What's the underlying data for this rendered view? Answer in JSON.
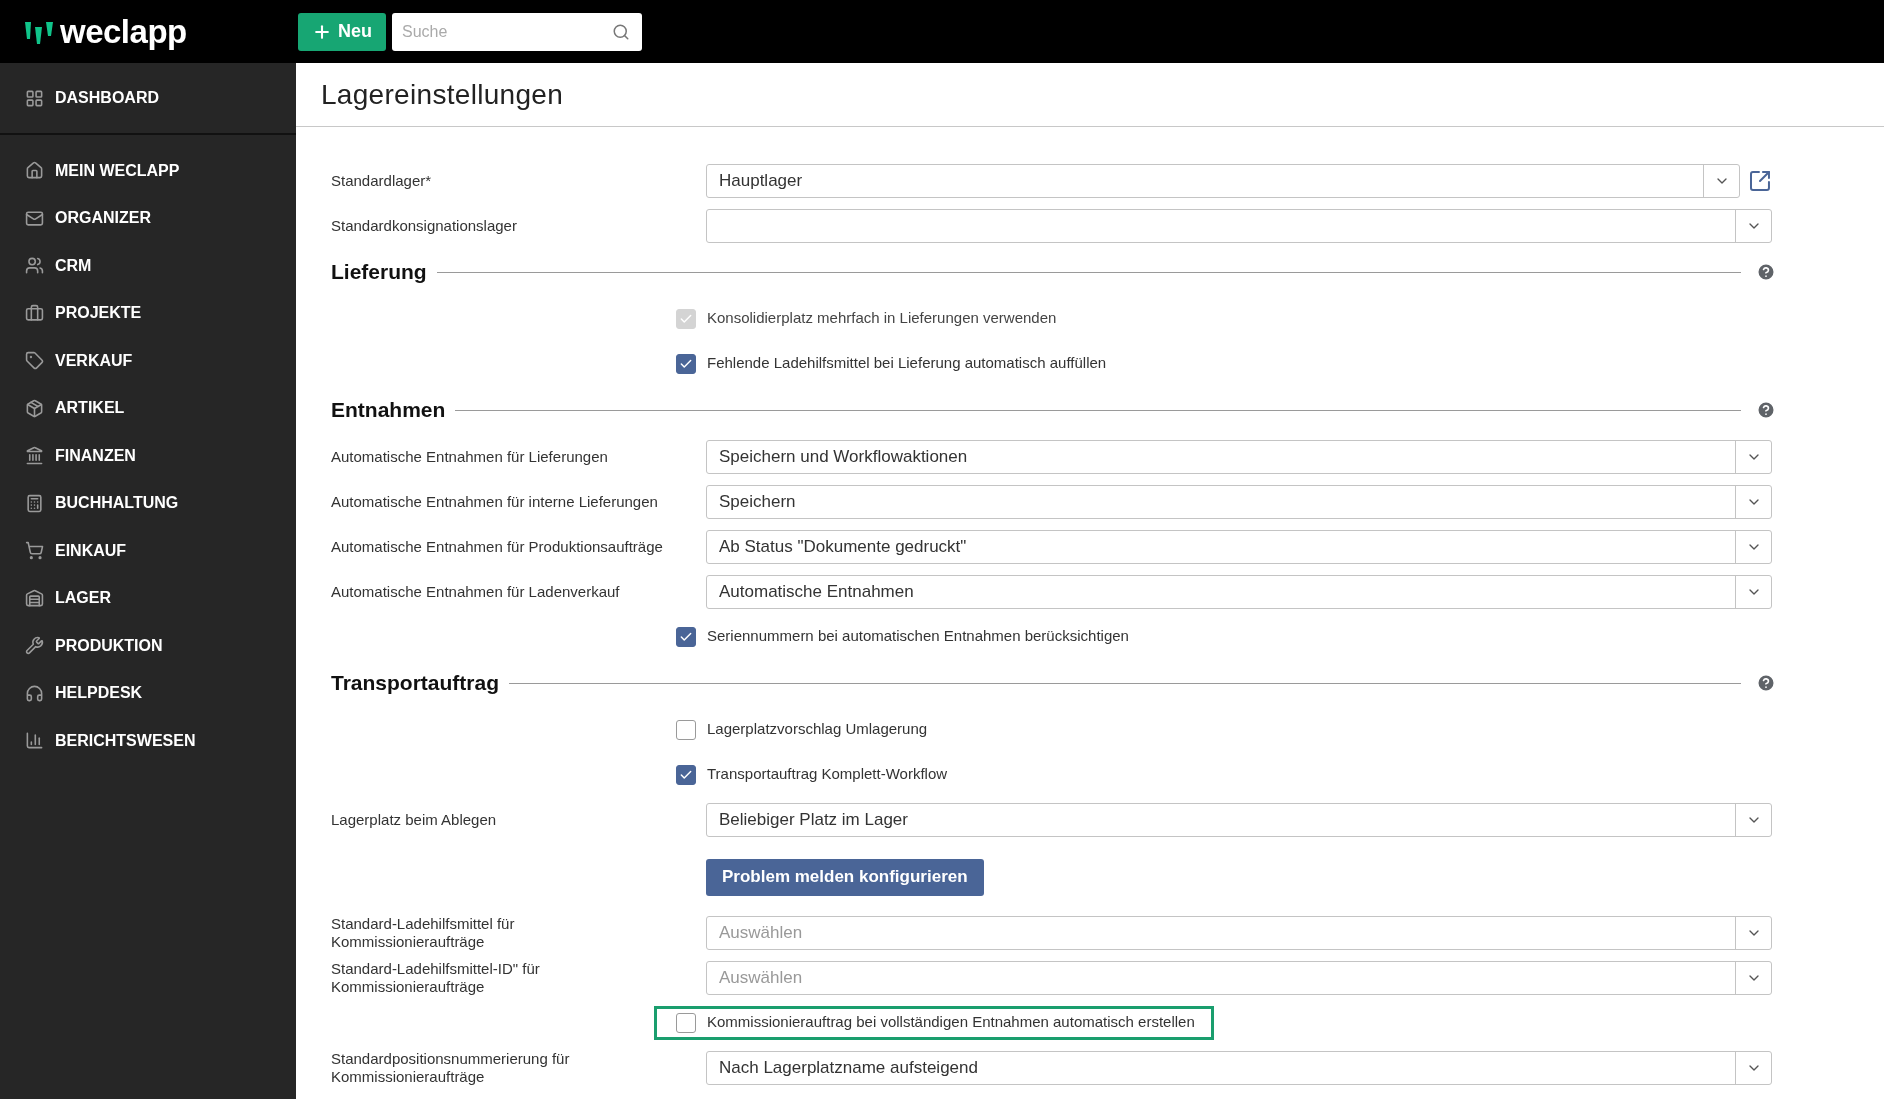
{
  "topbar": {
    "logo": "weclapp",
    "new_button": "Neu",
    "search": {
      "placeholder": "Suche"
    }
  },
  "sidebar": {
    "items": [
      {
        "label": "DASHBOARD"
      },
      {
        "label": "MEIN WECLAPP"
      },
      {
        "label": "ORGANIZER"
      },
      {
        "label": "CRM"
      },
      {
        "label": "PROJEKTE"
      },
      {
        "label": "VERKAUF"
      },
      {
        "label": "ARTIKEL"
      },
      {
        "label": "FINANZEN"
      },
      {
        "label": "BUCHHALTUNG"
      },
      {
        "label": "EINKAUF"
      },
      {
        "label": "LAGER"
      },
      {
        "label": "PRODUKTION"
      },
      {
        "label": "HELPDESK"
      },
      {
        "label": "BERICHTSWESEN"
      }
    ]
  },
  "page_title": "Lagereinstellungen",
  "sections": [
    {
      "items": [
        {
          "kind": "select",
          "label": "Standardlager*",
          "value": "Hauptlager",
          "link": true
        },
        {
          "kind": "select",
          "label": "Standardkonsignationslager",
          "value": "",
          "link": false
        }
      ]
    },
    {
      "title": "Lieferung",
      "help": true,
      "items": [
        {
          "kind": "checkbox",
          "label": "Konsolidierplatz mehrfach in Lieferungen verwenden",
          "checked": true,
          "disabled": true,
          "highlighted": false
        },
        {
          "kind": "checkbox",
          "label": "Fehlende Ladehilfsmittel bei Lieferung automatisch auffüllen",
          "checked": true,
          "disabled": false,
          "highlighted": false
        }
      ]
    },
    {
      "title": "Entnahmen",
      "help": true,
      "items": [
        {
          "kind": "select",
          "label": "Automatische Entnahmen für Lieferungen",
          "value": "Speichern und Workflowaktionen",
          "link": false
        },
        {
          "kind": "select",
          "label": "Automatische Entnahmen für interne Lieferungen",
          "value": "Speichern",
          "link": false
        },
        {
          "kind": "select",
          "label": "Automatische Entnahmen für Produktionsaufträge",
          "value": "Ab Status \"Dokumente gedruckt\"",
          "link": false
        },
        {
          "kind": "select",
          "label": "Automatische Entnahmen für Ladenverkauf",
          "value": "Automatische Entnahmen",
          "link": false
        },
        {
          "kind": "checkbox",
          "label": "Seriennummern bei automatischen Entnahmen berücksichtigen",
          "checked": true,
          "disabled": false,
          "highlighted": false
        }
      ]
    },
    {
      "title": "Transportauftrag",
      "help": true,
      "items": [
        {
          "kind": "checkbox",
          "label": "Lagerplatzvorschlag Umlagerung",
          "checked": false,
          "disabled": false,
          "highlighted": false
        },
        {
          "kind": "checkbox",
          "label": "Transportauftrag Komplett-Workflow",
          "checked": true,
          "disabled": false,
          "highlighted": false
        },
        {
          "kind": "select",
          "label": "Lagerplatz beim Ablegen",
          "value": "Beliebiger Platz im Lager",
          "link": false
        },
        {
          "kind": "button",
          "label": "Problem melden konfigurieren"
        },
        {
          "kind": "select",
          "label": "Standard-Ladehilfsmittel für Kommissionieraufträge",
          "placeholder": "Auswählen",
          "link": false
        },
        {
          "kind": "select",
          "label": "Standard-Ladehilfsmittel-ID\" für Kommissionieraufträge",
          "placeholder": "Auswählen",
          "link": false
        },
        {
          "kind": "checkbox",
          "label": "Kommissionierauftrag bei vollständigen Entnahmen automatisch erstellen",
          "checked": false,
          "disabled": false,
          "highlighted": true
        },
        {
          "kind": "select",
          "label": "Standardpositionsnummerierung für Kommissionieraufträge",
          "value": "Nach Lagerplatzname aufsteigend",
          "link": false
        }
      ]
    }
  ]
}
